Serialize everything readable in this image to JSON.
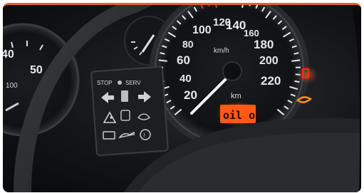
{
  "left_gauge": {
    "ticks": [
      "40",
      "50",
      "100"
    ]
  },
  "speedometer": {
    "numbers": [
      "20",
      "40",
      "60",
      "80",
      "100",
      "120",
      "140",
      "160",
      "180",
      "200",
      "220"
    ],
    "unit": "km/h",
    "odo_unit": "km"
  },
  "warning_panel": {
    "stop_label": "STOP",
    "serv_label": "SERV"
  },
  "display": {
    "text": "oil ok"
  },
  "colors": {
    "accent": "#e8622a",
    "display": "#ff5a14",
    "warning_red": "#ff2a10",
    "warning_amber": "#ff8c1a"
  }
}
